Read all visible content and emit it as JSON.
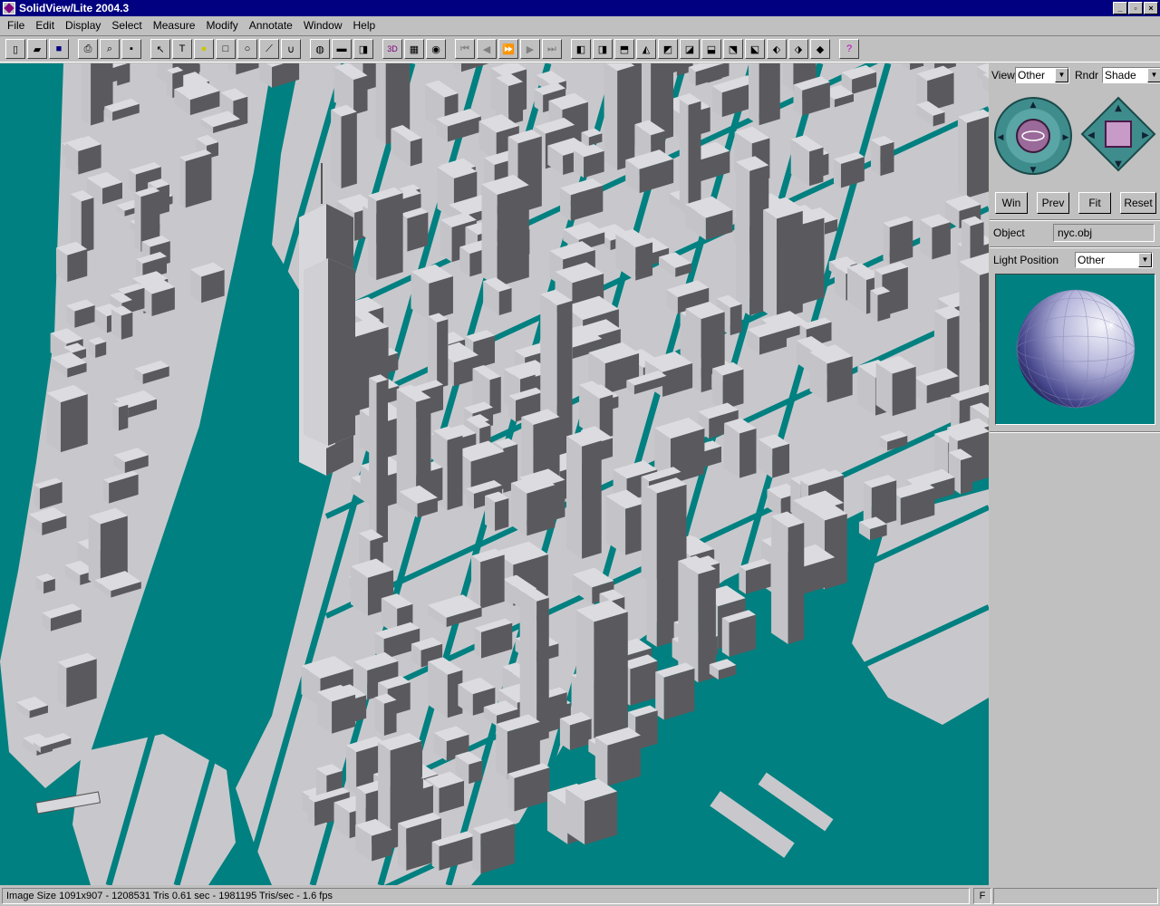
{
  "window": {
    "title": "SolidView/Lite 2004.3",
    "buttons": [
      "_",
      "▫",
      "×"
    ]
  },
  "menu": [
    "File",
    "Edit",
    "Display",
    "Select",
    "Measure",
    "Modify",
    "Annotate",
    "Window",
    "Help"
  ],
  "toolbar": {
    "tools": [
      {
        "name": "new-file-icon",
        "glyph": "▯"
      },
      {
        "name": "open-folder-icon",
        "glyph": "▰"
      },
      {
        "name": "save-icon",
        "glyph": "■"
      },
      {
        "name": "print-icon",
        "glyph": "⎙"
      },
      {
        "name": "print-preview-icon",
        "glyph": "⌕"
      },
      {
        "name": "blank-tool-icon",
        "glyph": "▪"
      },
      {
        "name": "select-arrow-icon",
        "glyph": "↖"
      },
      {
        "name": "text-tool-icon",
        "glyph": "T"
      },
      {
        "name": "note-icon",
        "glyph": "●"
      },
      {
        "name": "rectangle-icon",
        "glyph": "□"
      },
      {
        "name": "ellipse-icon",
        "glyph": "○"
      },
      {
        "name": "line-icon",
        "glyph": "⟋"
      },
      {
        "name": "arc-icon",
        "glyph": "∪"
      },
      {
        "name": "globe-icon",
        "glyph": "◍"
      },
      {
        "name": "shape-grey-icon",
        "glyph": "▬"
      },
      {
        "name": "shape-grey-2-icon",
        "glyph": "◨"
      },
      {
        "name": "3d-view-icon",
        "glyph": "3D"
      },
      {
        "name": "film-strip-icon",
        "glyph": "▦"
      },
      {
        "name": "camera-icon",
        "glyph": "◉"
      },
      {
        "name": "rewind-icon",
        "glyph": "⏮"
      },
      {
        "name": "step-back-icon",
        "glyph": "◀"
      },
      {
        "name": "play-fast-icon",
        "glyph": "⏩"
      },
      {
        "name": "step-forward-icon",
        "glyph": "▶"
      },
      {
        "name": "to-end-icon",
        "glyph": "⏭"
      },
      {
        "name": "view-front-icon",
        "glyph": "◧"
      },
      {
        "name": "view-back-icon",
        "glyph": "◨"
      },
      {
        "name": "view-top-icon",
        "glyph": "⬒"
      },
      {
        "name": "view-bottom-icon",
        "glyph": "◭"
      },
      {
        "name": "view-left-icon",
        "glyph": "◩"
      },
      {
        "name": "view-right-icon",
        "glyph": "◪"
      },
      {
        "name": "view-iso-1-icon",
        "glyph": "⬓"
      },
      {
        "name": "view-iso-2-icon",
        "glyph": "⬔"
      },
      {
        "name": "view-iso-3-icon",
        "glyph": "⬕"
      },
      {
        "name": "view-iso-4-icon",
        "glyph": "⬖"
      },
      {
        "name": "view-iso-5-icon",
        "glyph": "⬗"
      },
      {
        "name": "view-iso-6-icon",
        "glyph": "◆"
      },
      {
        "name": "help-icon",
        "glyph": "?"
      }
    ]
  },
  "panel": {
    "view_label": "View",
    "view_value": "Other",
    "rndr_label": "Rndr",
    "rndr_value": "Shade",
    "buttons": [
      "Win",
      "Prev",
      "Fit",
      "Reset"
    ],
    "object_label": "Object",
    "object_value": "nyc.obj",
    "light_label": "Light Position",
    "light_value": "Other"
  },
  "status": {
    "main": "Image Size 1091x907 - 1208531 Tris   0.61 sec - 1981195 Tris/sec - 1.6 fps",
    "mode": "F"
  },
  "colors": {
    "water": "#008080",
    "land": "#c8c8cc",
    "building_light": "#d0d0d4",
    "building_dark": "#58585c",
    "titlebar": "#000080"
  }
}
